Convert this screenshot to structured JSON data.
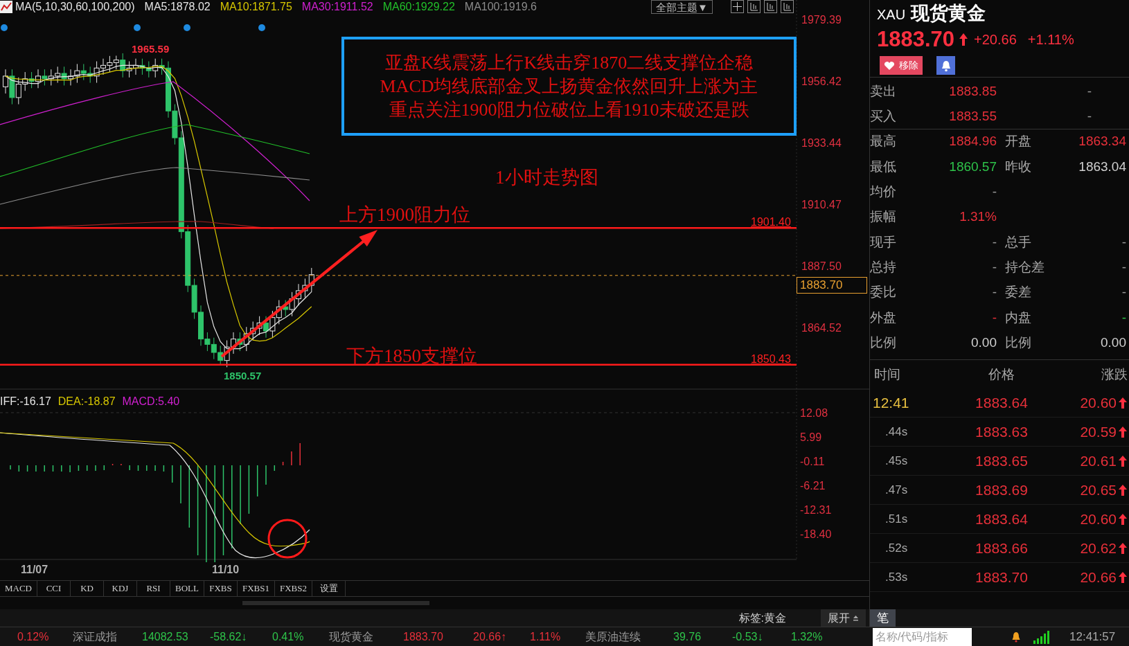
{
  "chart": {
    "ma_legend": [
      {
        "text": "MA(5,10,30,60,100,200)",
        "color": "#e6e6e6"
      },
      {
        "text": "MA5:1878.02",
        "color": "#e6e6e6"
      },
      {
        "text": "MA10:1871.75",
        "color": "#d8c800"
      },
      {
        "text": "MA30:1911.52",
        "color": "#d020d0"
      },
      {
        "text": "MA60:1929.22",
        "color": "#22c02a"
      },
      {
        "text": "MA100:1919.6",
        "color": "#8c8c8c"
      }
    ],
    "theme_button": "全部主题▼",
    "price_axis": [
      "1979.39",
      "1956.42",
      "1933.44",
      "1910.47",
      "1887.50",
      "1864.52"
    ],
    "high_label": "1965.59",
    "low_label": "1850.57",
    "resistance": {
      "value": "1901.40",
      "note": "上方1900阻力位"
    },
    "support": {
      "value": "1850.43",
      "note": "下方1850支撑位"
    },
    "current_price": "1883.70",
    "commentary": [
      "亚盘K线震荡上行K线击穿1870二线支撑位企稳",
      "MACD均线底部金叉上扬黄金依然回升上涨为主",
      "重点关注1900阻力位破位上看1910未破还是跌"
    ],
    "caption": "1小时走势图"
  },
  "macd": {
    "legend": [
      {
        "text": "IFF:-16.17",
        "color": "#e6e6e6"
      },
      {
        "text": "DEA:-18.87",
        "color": "#d8c800"
      },
      {
        "text": "MACD:5.40",
        "color": "#d020d0"
      }
    ],
    "axis": [
      "12.08",
      "5.99",
      "-0.11",
      "-6.21",
      "-12.31",
      "-18.40"
    ],
    "dates": [
      "11/07",
      "11/10"
    ]
  },
  "indicator_tabs": [
    "MACD",
    "CCI",
    "KD",
    "KDJ",
    "RSI",
    "BOLL",
    "FXBS",
    "FXBS1",
    "FXBS2",
    "设置"
  ],
  "tag_label": "标签:黄金",
  "expand_button": "展开",
  "quote": {
    "code": "XAU",
    "name": "现货黄金",
    "price": "1883.70",
    "change": "+20.66",
    "percent": "+1.11%",
    "remove_button": "移除",
    "rows": [
      {
        "cells": [
          {
            "label": "卖出",
            "value": "1883.85",
            "color": "#e8303a"
          },
          {
            "value": "-",
            "color": "#9a9a9a"
          }
        ]
      },
      {
        "cells": [
          {
            "label": "买入",
            "value": "1883.55",
            "color": "#e8303a"
          },
          {
            "value": "-",
            "color": "#9a9a9a"
          }
        ]
      },
      {
        "cells": [
          {
            "label": "最高",
            "value": "1884.96",
            "color": "#e8303a"
          },
          {
            "label": "开盘",
            "value": "1863.34",
            "color": "#e8303a"
          }
        ]
      },
      {
        "cells": [
          {
            "label": "最低",
            "value": "1860.57",
            "color": "#2ec44a"
          },
          {
            "label": "昨收",
            "value": "1863.04",
            "color": "#d0d0d0"
          }
        ]
      },
      {
        "cells": [
          {
            "label": "均价",
            "value": "-",
            "color": "#9a9a9a"
          }
        ]
      },
      {
        "cells": [
          {
            "label": "振幅",
            "value": "1.31%",
            "color": "#e8303a"
          }
        ]
      },
      {
        "cells": [
          {
            "label": "现手",
            "value": "-",
            "color": "#9a9a9a"
          },
          {
            "label": "总手",
            "value": "-",
            "color": "#9a9a9a"
          }
        ]
      },
      {
        "cells": [
          {
            "label": "总持",
            "value": "-",
            "color": "#9a9a9a"
          },
          {
            "label": "持仓差",
            "value": "-",
            "color": "#9a9a9a"
          }
        ]
      },
      {
        "cells": [
          {
            "label": "委比",
            "value": "-",
            "color": "#9a9a9a"
          },
          {
            "label": "委差",
            "value": "-",
            "color": "#9a9a9a"
          }
        ]
      },
      {
        "cells": [
          {
            "label": "外盘",
            "value": "-",
            "color": "#e8303a"
          },
          {
            "label": "内盘",
            "value": "-",
            "color": "#2ec44a"
          }
        ]
      },
      {
        "cells": [
          {
            "label": "比例",
            "value": "0.00",
            "color": "#d0d0d0"
          },
          {
            "label": "比例",
            "value": "0.00",
            "color": "#d0d0d0"
          }
        ]
      }
    ]
  },
  "trades": {
    "columns": [
      "时间",
      "价格",
      "涨跌"
    ],
    "rows": [
      {
        "kind": "full",
        "time": "12:41",
        "price": "1883.64",
        "change": "20.60"
      },
      {
        "kind": "sub",
        "time": ".44s",
        "price": "1883.63",
        "change": "20.59"
      },
      {
        "kind": "sub",
        "time": ".45s",
        "price": "1883.65",
        "change": "20.61"
      },
      {
        "kind": "sub",
        "time": ".47s",
        "price": "1883.69",
        "change": "20.65"
      },
      {
        "kind": "sub",
        "time": ".51s",
        "price": "1883.64",
        "change": "20.60"
      },
      {
        "kind": "sub",
        "time": ".52s",
        "price": "1883.66",
        "change": "20.62"
      },
      {
        "kind": "sub",
        "time": ".53s",
        "price": "1883.70",
        "change": "20.66"
      }
    ]
  },
  "side_tab": "笔",
  "ticker": [
    {
      "text": "0.12%",
      "color": "#e8303a"
    },
    {
      "text": "深证成指",
      "color": "#9a9a9a"
    },
    {
      "text": "14082.53",
      "color": "#2ec44a"
    },
    {
      "text": "-58.62↓",
      "color": "#2ec44a"
    },
    {
      "text": "0.41%",
      "color": "#2ec44a"
    },
    {
      "text": "现货黄金",
      "color": "#9a9a9a"
    },
    {
      "text": "1883.70",
      "color": "#e8303a"
    },
    {
      "text": "20.66↑",
      "color": "#e8303a"
    },
    {
      "text": "1.11%",
      "color": "#e8303a"
    },
    {
      "text": "美原油连续",
      "color": "#9a9a9a"
    },
    {
      "text": "39.76",
      "color": "#2ec44a"
    },
    {
      "text": "-0.53↓",
      "color": "#2ec44a"
    },
    {
      "text": "1.32%",
      "color": "#2ec44a"
    }
  ],
  "search": {
    "placeholder": "名称/代码/指标"
  },
  "clock": "12:41:57"
}
